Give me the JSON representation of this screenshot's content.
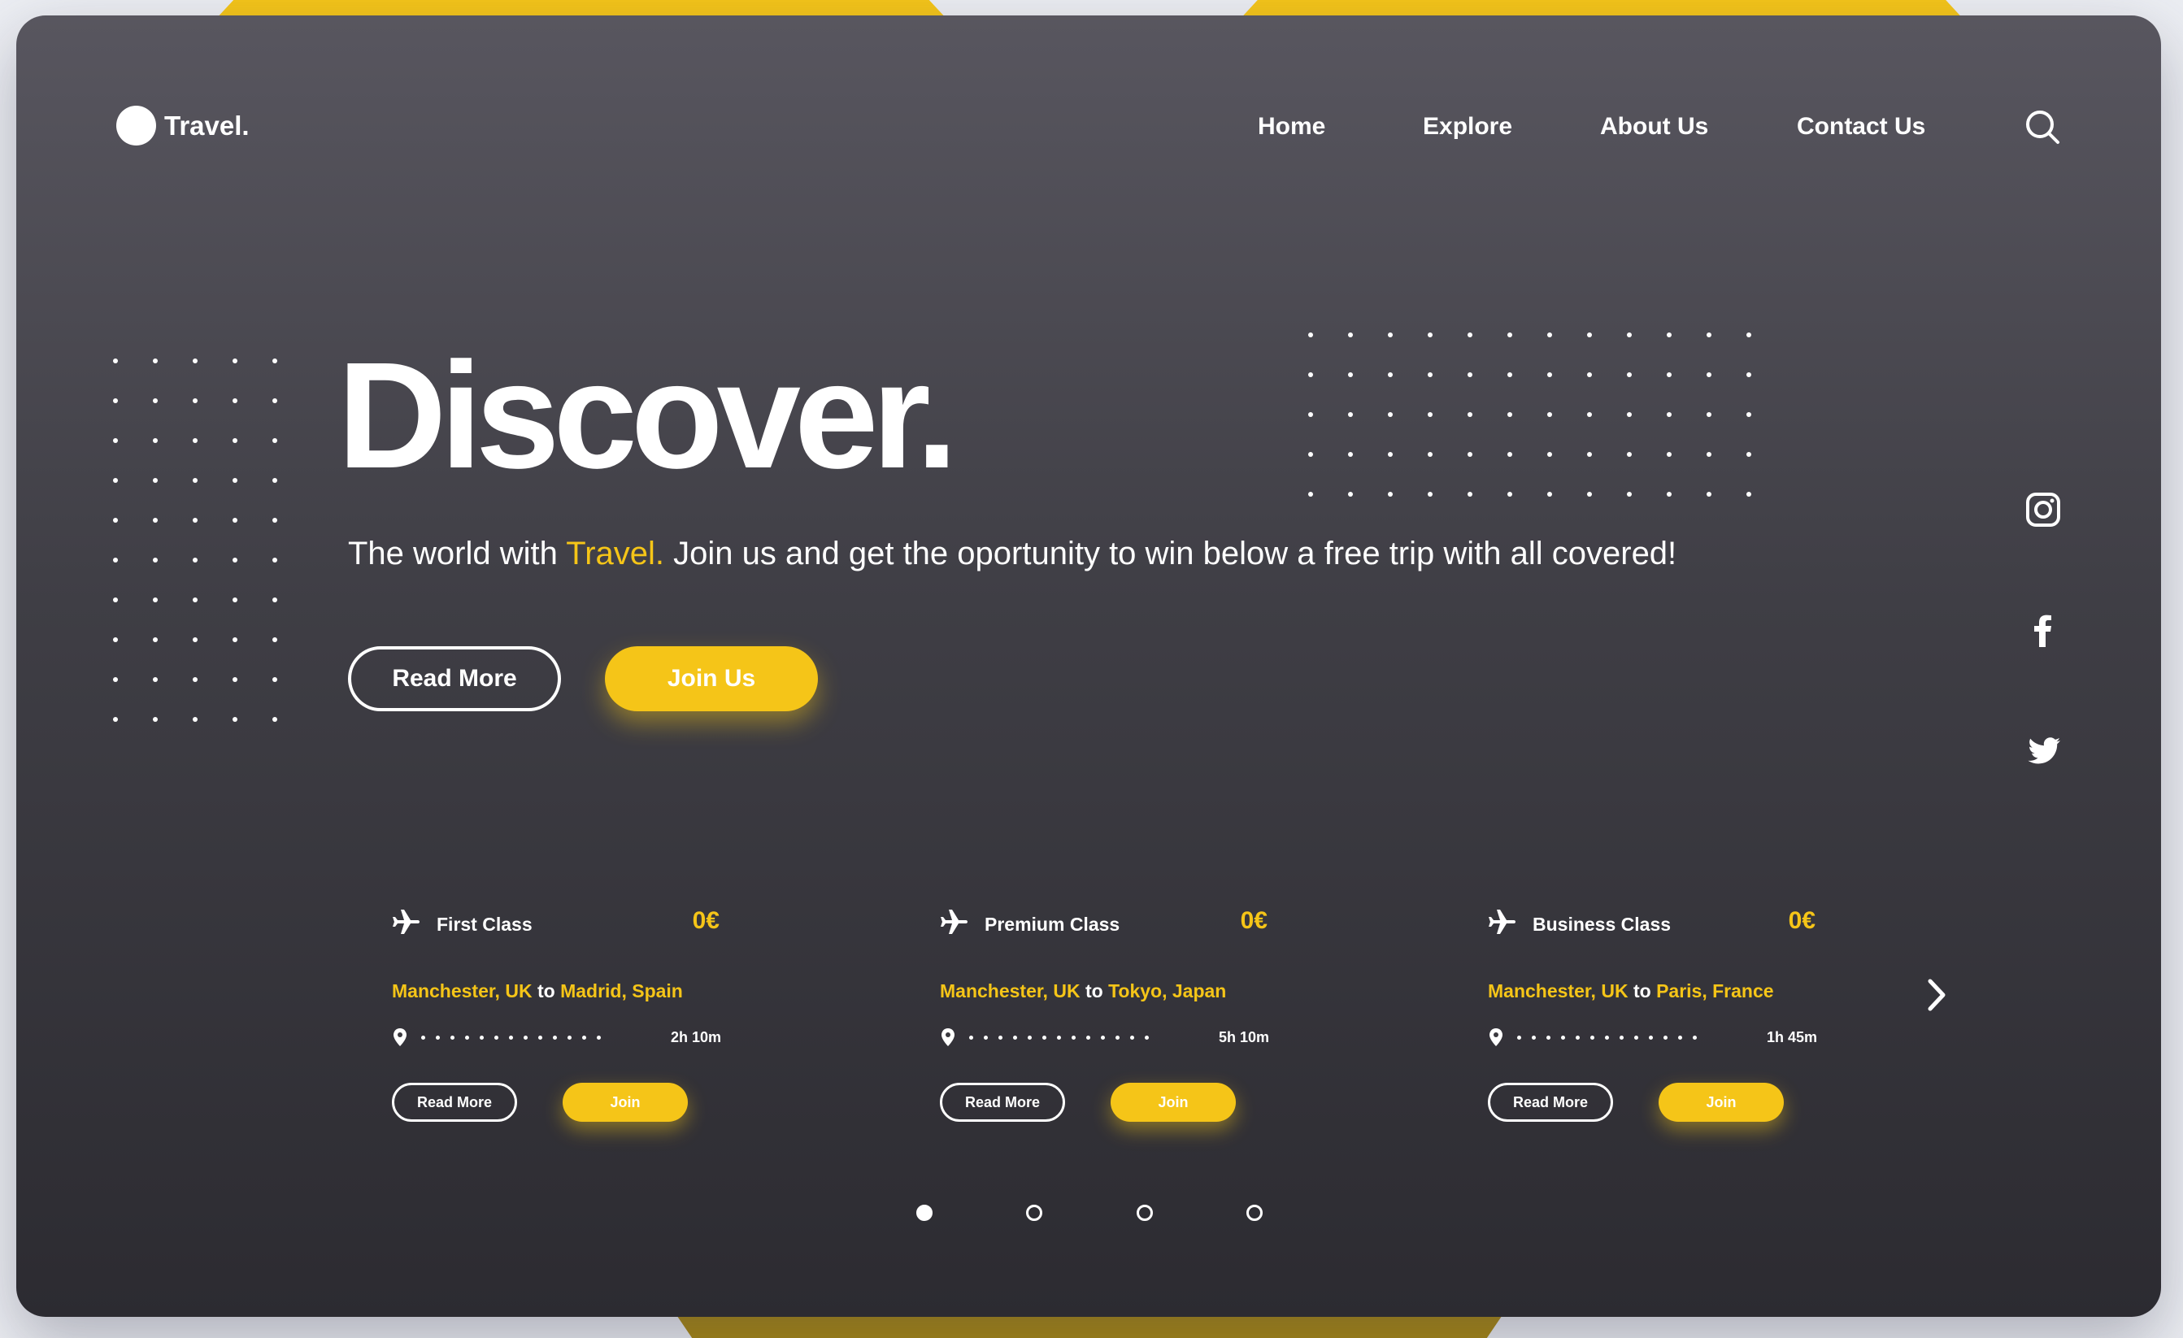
{
  "brand": {
    "name": "Travel."
  },
  "nav": {
    "items": [
      "Home",
      "Explore",
      "About Us",
      "Contact Us"
    ]
  },
  "hero": {
    "title": "Discover.",
    "subtitle_before": "The world with ",
    "subtitle_highlight": "Travel.",
    "subtitle_after": " Join us and get the oportunity to win below a free trip with all covered!",
    "read_more_label": "Read More",
    "join_label": "Join Us"
  },
  "offers": [
    {
      "name": "First Class",
      "price": "0€",
      "from": "Manchester, UK",
      "connector": " to ",
      "to": "Madrid, Spain",
      "duration": "2h 10m",
      "read_more": "Read More",
      "join": "Join"
    },
    {
      "name": "Premium Class",
      "price": "0€",
      "from": "Manchester, UK",
      "connector": " to ",
      "to": "Tokyo, Japan",
      "duration": "5h 10m",
      "read_more": "Read More",
      "join": "Join"
    },
    {
      "name": "Business Class",
      "price": "0€",
      "from": "Manchester, UK",
      "connector": " to ",
      "to": "Paris, France",
      "duration": "1h 45m",
      "read_more": "Read More",
      "join": "Join"
    }
  ],
  "social": [
    "instagram-icon",
    "facebook-icon",
    "twitter-icon"
  ],
  "pagination": {
    "count": 4,
    "active": 0
  },
  "colors": {
    "accent": "#f5c518",
    "background_top": "#58565f",
    "background_bottom": "#2c2b31",
    "text": "#ffffff"
  }
}
